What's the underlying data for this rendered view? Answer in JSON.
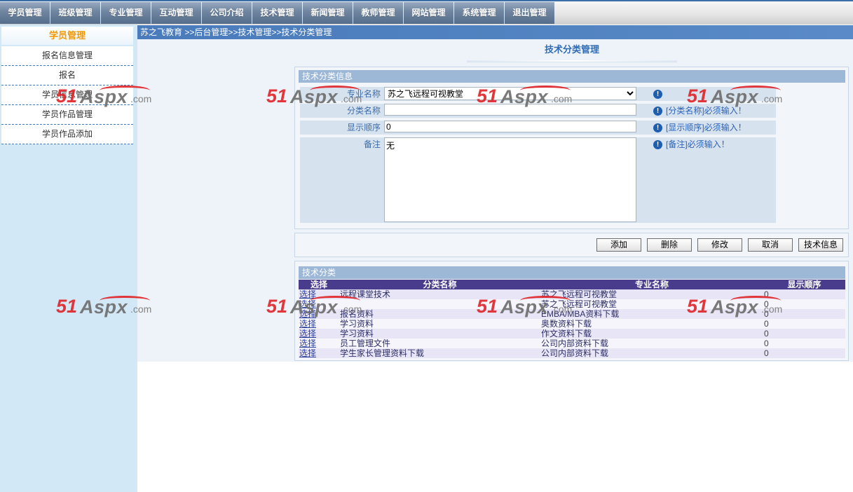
{
  "nav": {
    "tabs": [
      "学员管理",
      "班级管理",
      "专业管理",
      "互动管理",
      "公司介绍",
      "技术管理",
      "新闻管理",
      "教师管理",
      "网站管理",
      "系统管理",
      "退出管理"
    ]
  },
  "sidebar": {
    "title": "学员管理",
    "items": [
      "报名信息管理",
      "报名",
      "学员信息管理",
      "学员作品管理",
      "学员作品添加"
    ]
  },
  "breadcrumb": "苏之飞教育 >>后台管理>>技术管理>>技术分类管理",
  "page_title": "技术分类管理",
  "form": {
    "section_title": "技术分类信息",
    "major": {
      "label": "专业名称",
      "value": "苏之飞远程可视教堂"
    },
    "category": {
      "label": "分类名称",
      "value": "",
      "message": "[分类名称]必须输入！"
    },
    "order": {
      "label": "显示顺序",
      "value": "0",
      "message": "[显示顺序]必须输入！"
    },
    "remark": {
      "label": "备注",
      "value": "无",
      "message": "[备注]必须输入！"
    }
  },
  "buttons": {
    "add": "添加",
    "delete": "删除",
    "edit": "修改",
    "cancel": "取消",
    "tech_info": "技术信息"
  },
  "table": {
    "section_title": "技术分类",
    "columns": [
      "选择",
      "分类名称",
      "专业名称",
      "显示顺序"
    ],
    "rows": [
      {
        "select": "选择",
        "name": "远程课堂技术",
        "major": "苏之飞远程可视教堂",
        "order": "0"
      },
      {
        "select": "选择",
        "name": "",
        "major": "苏之飞远程可视教堂",
        "order": "0"
      },
      {
        "select": "选择",
        "name": "报名资料",
        "major": "EMBA/MBA资料下载",
        "order": "0"
      },
      {
        "select": "选择",
        "name": "学习资料",
        "major": "奥数资料下载",
        "order": "0"
      },
      {
        "select": "选择",
        "name": "学习资料",
        "major": "作文资料下载",
        "order": "0"
      },
      {
        "select": "选择",
        "name": "员工管理文件",
        "major": "公司内部资料下载",
        "order": "0"
      },
      {
        "select": "选择",
        "name": "学生家长管理资料下载",
        "major": "公司内部资料下载",
        "order": "0"
      }
    ]
  },
  "watermark": {
    "num": "51",
    "brand": "Aspx",
    "suffix": ".com"
  },
  "icons": {
    "field_hint": "exclamation-circle-icon"
  },
  "colors": {
    "accent": "#f39800",
    "breadcrumb_bg": "#4f80bf",
    "table_header_bg": "#4a3c8c",
    "section_header_bg": "#9db8d7"
  }
}
